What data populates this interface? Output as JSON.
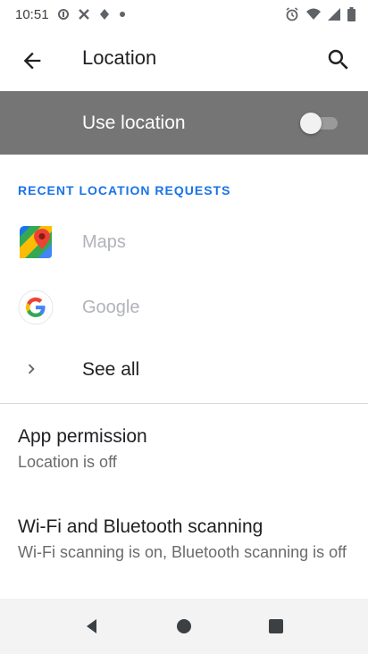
{
  "status_bar": {
    "time": "10:51",
    "left_icons": [
      "data-saver-icon",
      "tools-icon",
      "diamond-icon",
      "dot-icon"
    ],
    "right_icons": [
      "alarm-icon",
      "wifi-icon",
      "signal-icon",
      "battery-icon"
    ]
  },
  "app_bar": {
    "title": "Location",
    "back_icon": "arrow-back-icon",
    "search_icon": "search-icon"
  },
  "use_location": {
    "label": "Use location",
    "enabled": false
  },
  "recent_requests": {
    "header": "RECENT LOCATION REQUESTS",
    "apps": [
      {
        "name": "Maps",
        "icon": "google-maps-icon"
      },
      {
        "name": "Google",
        "icon": "google-g-icon"
      }
    ],
    "see_all": "See all"
  },
  "preferences": [
    {
      "title": "App permission",
      "summary": "Location is off"
    },
    {
      "title": "Wi-Fi and Bluetooth scanning",
      "summary": "Wi-Fi scanning is on, Bluetooth scanning is off"
    }
  ],
  "colors": {
    "accent": "#1a73e8",
    "header_bg": "#757575",
    "disabled_text": "#b0b3b8"
  },
  "nav_bar": {
    "icons": [
      "nav-back-icon",
      "nav-home-icon",
      "nav-recents-icon"
    ]
  }
}
